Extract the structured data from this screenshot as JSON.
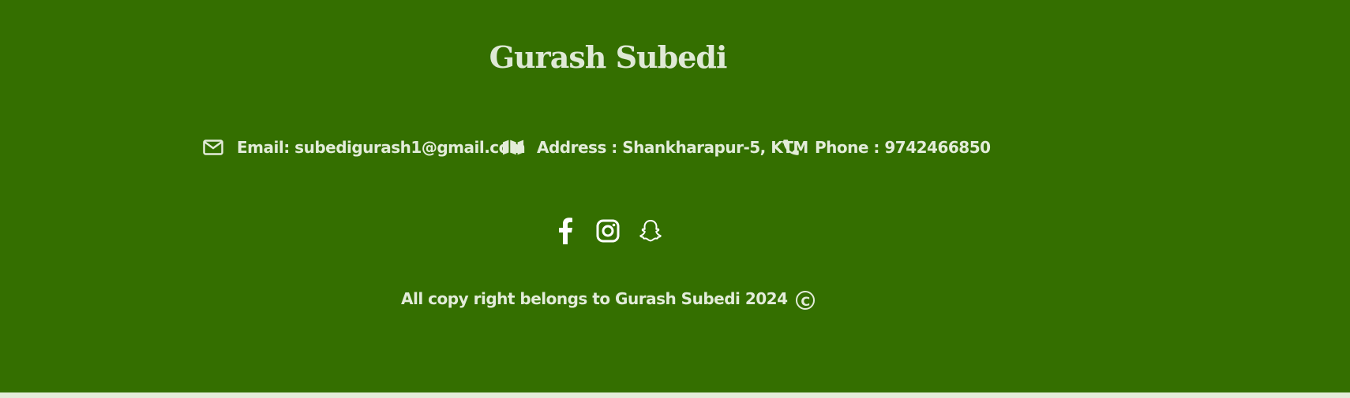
{
  "footer": {
    "title": "Gurash Subedi",
    "contact": {
      "email": {
        "icon": "envelope-icon",
        "label": "Email: subedigurash1@gmail.com"
      },
      "address": {
        "icon": "map-icon",
        "label": "Address : Shankharapur-5, KTM"
      },
      "phone": {
        "icon": "phone-icon",
        "label": "Phone : 9742466850"
      }
    },
    "social": [
      {
        "icon": "facebook-icon"
      },
      {
        "icon": "instagram-icon"
      },
      {
        "icon": "snapchat-icon"
      }
    ],
    "copyright": {
      "text": "All copy right belongs to Gurash Subedi 2024",
      "symbol": "C"
    }
  },
  "colors": {
    "footer_background": "#346f00",
    "text": "#e3ecd9",
    "page_background": "#e3ecd9"
  }
}
